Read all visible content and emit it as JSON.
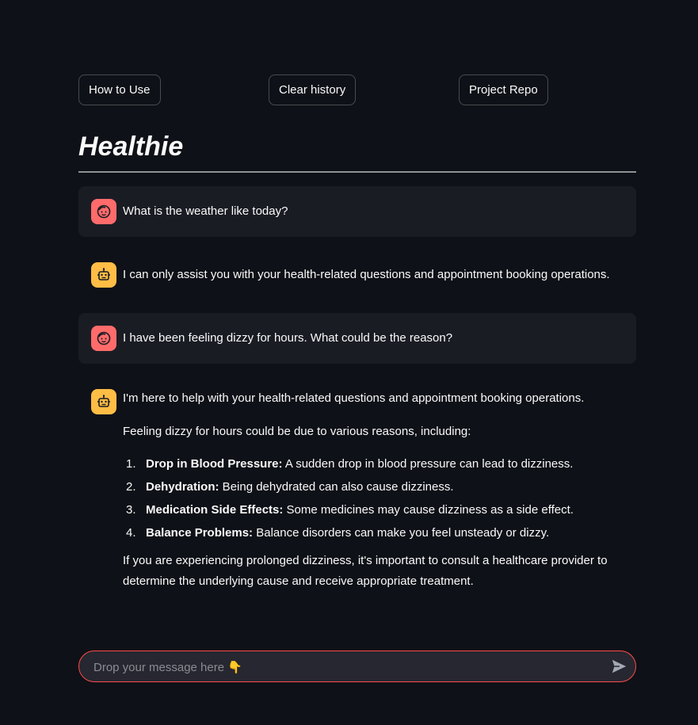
{
  "toolbar": {
    "how_to_use": "How to Use",
    "clear_history": "Clear history",
    "project_repo": "Project Repo"
  },
  "page": {
    "title": "Healthie"
  },
  "messages": {
    "user1": "What is the weather like today?",
    "bot1": "I can only assist you with your health-related questions and appointment booking operations.",
    "user2": "I have been feeling dizzy for hours. What could be the reason?",
    "bot2": {
      "intro": "I'm here to help with your health-related questions and appointment booking operations.",
      "lead": "Feeling dizzy for hours could be due to various reasons, including:",
      "items": [
        {
          "num": "1.",
          "title": "Drop in Blood Pressure:",
          "text": " A sudden drop in blood pressure can lead to dizziness."
        },
        {
          "num": "2.",
          "title": "Dehydration:",
          "text": " Being dehydrated can also cause dizziness."
        },
        {
          "num": "3.",
          "title": "Medication Side Effects:",
          "text": " Some medicines may cause dizziness as a side effect."
        },
        {
          "num": "4.",
          "title": "Balance Problems:",
          "text": " Balance disorders can make you feel unsteady or dizzy."
        }
      ],
      "outro": "If you are experiencing prolonged dizziness, it's important to consult a healthcare provider to determine the underlying cause and receive appropriate treatment."
    }
  },
  "chat_input": {
    "placeholder": "Drop your message here 👇"
  },
  "icons": {
    "user_avatar": "face-icon",
    "bot_avatar": "robot-icon",
    "send": "send-icon"
  },
  "colors": {
    "background": "#0e1117",
    "user_message_bg": "#1a1c24",
    "user_avatar": "#ff6b6b",
    "bot_avatar": "#ffbd45",
    "input_border": "#ff4b4b"
  }
}
